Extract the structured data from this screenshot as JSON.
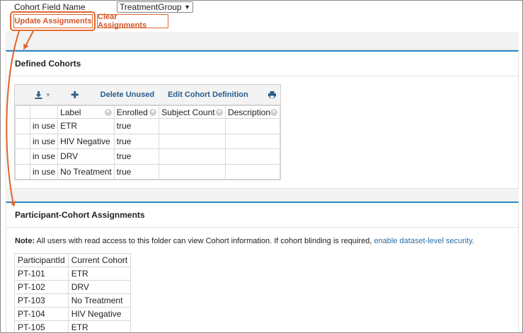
{
  "cohort_field": {
    "label": "Cohort Field Name",
    "selected_value": "TreatmentGroup"
  },
  "actions": {
    "update_label": "Update Assignments",
    "clear_label": "Clear Assignments"
  },
  "defined_cohorts": {
    "title": "Defined Cohorts",
    "toolbar": {
      "export_icon": "download-icon",
      "add_icon": "plus-icon",
      "delete_unused_label": "Delete Unused",
      "edit_definition_label": "Edit Cohort Definition",
      "print_icon": "print-icon"
    },
    "columns": [
      "Label",
      "Enrolled",
      "Subject Count",
      "Description"
    ],
    "rows": [
      {
        "status": "in use",
        "label": "ETR",
        "enrolled": "true",
        "subject_count": "",
        "description": ""
      },
      {
        "status": "in use",
        "label": "HIV Negative",
        "enrolled": "true",
        "subject_count": "",
        "description": ""
      },
      {
        "status": "in use",
        "label": "DRV",
        "enrolled": "true",
        "subject_count": "",
        "description": ""
      },
      {
        "status": "in use",
        "label": "No Treatment",
        "enrolled": "true",
        "subject_count": "",
        "description": ""
      }
    ]
  },
  "assignments": {
    "title": "Participant-Cohort Assignments",
    "note_label": "Note:",
    "note_text": " All users with read access to this folder can view Cohort information. If cohort blinding is required, ",
    "note_link": "enable dataset-level security",
    "note_end": ".",
    "columns": [
      "ParticipantId",
      "Current Cohort"
    ],
    "rows": [
      {
        "participant_id": "PT-101",
        "cohort": "ETR"
      },
      {
        "participant_id": "PT-102",
        "cohort": "DRV"
      },
      {
        "participant_id": "PT-103",
        "cohort": "No Treatment"
      },
      {
        "participant_id": "PT-104",
        "cohort": "HIV Negative"
      },
      {
        "participant_id": "PT-105",
        "cohort": "ETR"
      }
    ]
  },
  "colors": {
    "accent_orange": "#e0672f",
    "section_blue": "#2b86c5",
    "link_blue": "#2a6ea8"
  }
}
